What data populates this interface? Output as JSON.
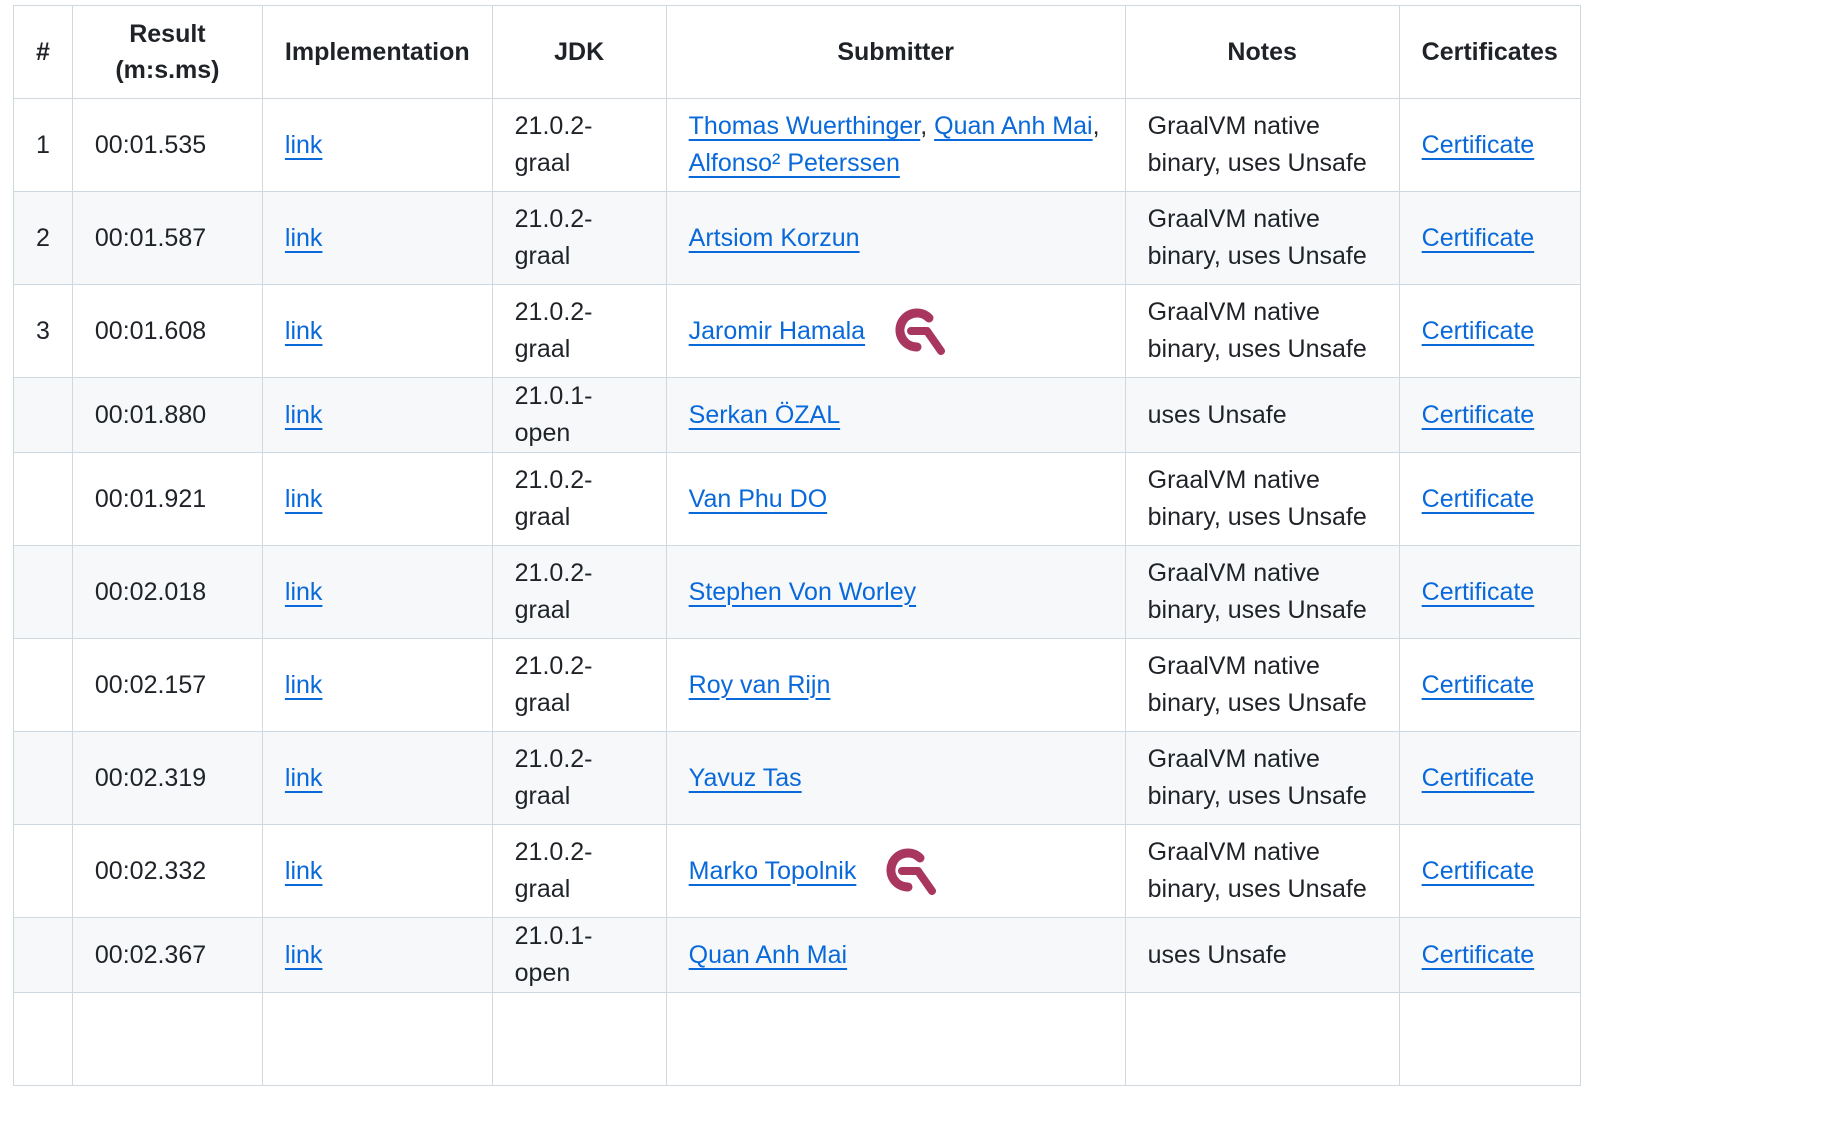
{
  "headers": {
    "rank": "#",
    "result_line1": "Result",
    "result_line2": "(m:s.ms)",
    "implementation": "Implementation",
    "jdk": "JDK",
    "submitter": "Submitter",
    "notes": "Notes",
    "certificates": "Certificates"
  },
  "link_label": "link",
  "certificate_label": "Certificate",
  "logo_icon": "graalvm-q-logo-icon",
  "colors": {
    "link": "#0969da",
    "border": "#d1d9e0",
    "stripe": "#f6f8fa",
    "logo": "#a8365f"
  },
  "rows": [
    {
      "rank": "1",
      "result": "00:01.535",
      "jdk": "21.0.2-graal",
      "submitters": [
        "Thomas Wuerthinger",
        "Quan Anh Mai",
        "Alfonso² Peterssen"
      ],
      "notes_line1": "GraalVM native",
      "notes_line2": "binary, uses Unsafe"
    },
    {
      "rank": "2",
      "result": "00:01.587",
      "jdk": "21.0.2-graal",
      "submitters": [
        "Artsiom Korzun"
      ],
      "notes_line1": "GraalVM native",
      "notes_line2": "binary, uses Unsafe"
    },
    {
      "rank": "3",
      "result": "00:01.608",
      "jdk": "21.0.2-graal",
      "submitters": [
        "Jaromir Hamala"
      ],
      "notes_line1": "GraalVM native",
      "notes_line2": "binary, uses Unsafe"
    },
    {
      "rank": "",
      "result": "00:01.880",
      "jdk": "21.0.1-open",
      "submitters": [
        "Serkan ÖZAL"
      ],
      "notes_line1": "uses Unsafe",
      "notes_line2": ""
    },
    {
      "rank": "",
      "result": "00:01.921",
      "jdk": "21.0.2-graal",
      "submitters": [
        "Van Phu DO"
      ],
      "notes_line1": "GraalVM native",
      "notes_line2": "binary, uses Unsafe"
    },
    {
      "rank": "",
      "result": "00:02.018",
      "jdk": "21.0.2-graal",
      "submitters": [
        "Stephen Von Worley"
      ],
      "notes_line1": "GraalVM native",
      "notes_line2": "binary, uses Unsafe"
    },
    {
      "rank": "",
      "result": "00:02.157",
      "jdk": "21.0.2-graal",
      "submitters": [
        "Roy van Rijn"
      ],
      "notes_line1": "GraalVM native",
      "notes_line2": "binary, uses Unsafe"
    },
    {
      "rank": "",
      "result": "00:02.319",
      "jdk": "21.0.2-graal",
      "submitters": [
        "Yavuz Tas"
      ],
      "notes_line1": "GraalVM native",
      "notes_line2": "binary, uses Unsafe"
    },
    {
      "rank": "",
      "result": "00:02.332",
      "jdk": "21.0.2-graal",
      "submitters": [
        "Marko Topolnik"
      ],
      "notes_line1": "GraalVM native",
      "notes_line2": "binary, uses Unsafe"
    },
    {
      "rank": "",
      "result": "00:02.367",
      "jdk": "21.0.1-open",
      "submitters": [
        "Quan Anh Mai"
      ],
      "notes_line1": "uses Unsafe",
      "notes_line2": ""
    }
  ]
}
